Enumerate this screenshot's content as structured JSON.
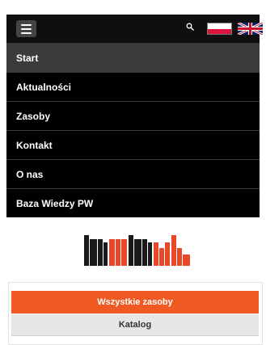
{
  "header": {
    "menu_icon": "hamburger-menu-icon",
    "search_icon": "search-icon",
    "languages": [
      {
        "name": "Polski",
        "icon": "flag-pl-icon"
      },
      {
        "name": "English",
        "icon": "flag-uk-icon"
      }
    ]
  },
  "nav": {
    "items": [
      {
        "label": "Start",
        "active": true
      },
      {
        "label": "Aktualności",
        "active": false
      },
      {
        "label": "Zasoby",
        "active": false
      },
      {
        "label": "Kontakt",
        "active": false
      },
      {
        "label": "O nas",
        "active": false
      },
      {
        "label": "Baza Wiedzy PW",
        "active": false
      }
    ]
  },
  "logo": {
    "icon": "library-logo-icon",
    "colors": [
      "#1a1a1a",
      "#e8472a"
    ]
  },
  "resources": {
    "tabs": [
      {
        "label": "Wszystkie zasoby",
        "active": true
      },
      {
        "label": "Katalog",
        "active": false
      }
    ]
  },
  "colors": {
    "accent": "#f05a22",
    "nav_bg": "#000000",
    "nav_active": "#3b3b3b"
  }
}
